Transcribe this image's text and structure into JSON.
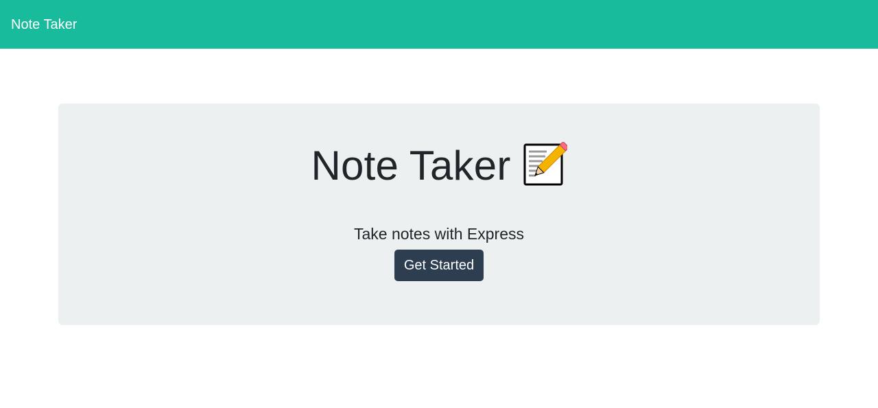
{
  "navbar": {
    "brand": "Note Taker",
    "background": "#18bc9c"
  },
  "hero": {
    "title": "Note Taker",
    "icon": "memo-pencil-icon",
    "subtitle": "Take notes with Express",
    "button_label": "Get Started",
    "background": "#ecf0f1",
    "button_color": "#2c3e50"
  }
}
